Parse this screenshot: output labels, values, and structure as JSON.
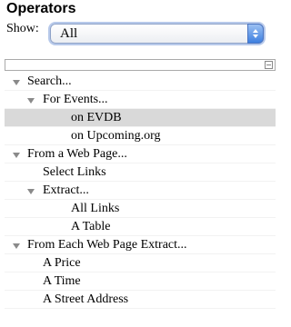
{
  "panel": {
    "title": "Operators",
    "show_label": "Show:",
    "show_value": "All"
  },
  "tree": [
    {
      "label": "Search...",
      "expander": true,
      "depth": 0,
      "selected": false
    },
    {
      "label": "For Events...",
      "expander": true,
      "depth": 1,
      "selected": false
    },
    {
      "label": "on EVDB",
      "expander": false,
      "depth": 2,
      "selected": true
    },
    {
      "label": "on Upcoming.org",
      "expander": false,
      "depth": 2,
      "selected": false
    },
    {
      "label": "From a Web Page...",
      "expander": true,
      "depth": 0,
      "selected": false
    },
    {
      "label": "Select Links",
      "expander": false,
      "depth": 1,
      "selected": false
    },
    {
      "label": "Extract...",
      "expander": true,
      "depth": 1,
      "selected": false
    },
    {
      "label": "All Links",
      "expander": false,
      "depth": 2,
      "selected": false
    },
    {
      "label": "A Table",
      "expander": false,
      "depth": 2,
      "selected": false
    },
    {
      "label": "From Each Web Page Extract...",
      "expander": true,
      "depth": 0,
      "selected": false
    },
    {
      "label": "A Price",
      "expander": false,
      "depth": 1,
      "selected": false
    },
    {
      "label": "A Time",
      "expander": false,
      "depth": 1,
      "selected": false
    },
    {
      "label": "A Street Address",
      "expander": false,
      "depth": 1,
      "selected": false
    }
  ]
}
